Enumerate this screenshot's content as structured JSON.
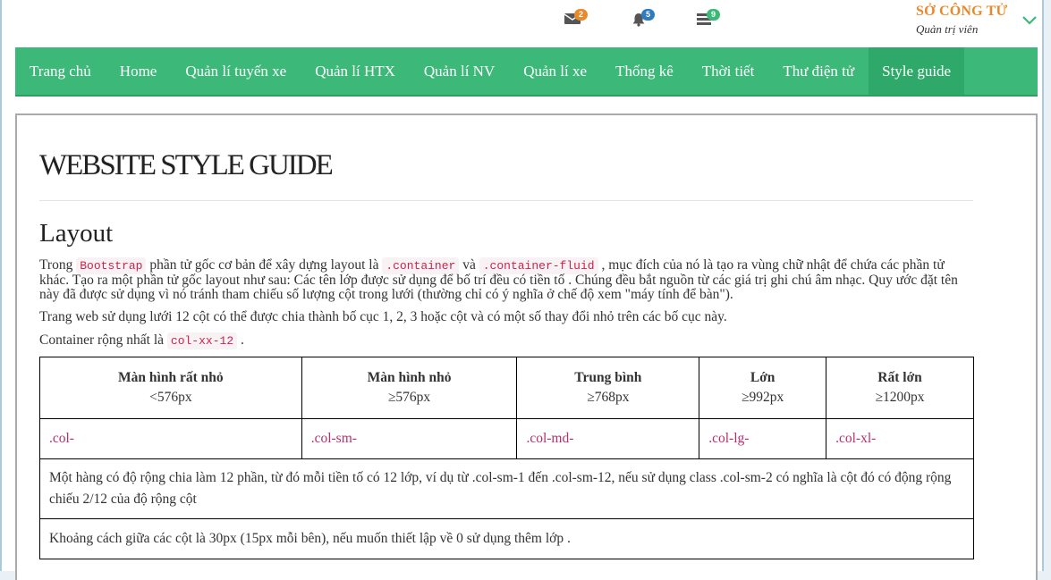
{
  "topbar": {
    "notifications": [
      {
        "icon": "envelope-icon",
        "count": "2",
        "color": "#e8892a"
      },
      {
        "icon": "bell-icon",
        "count": "5",
        "color": "#2e7bbf"
      },
      {
        "icon": "tasks-icon",
        "count": "9",
        "color": "#3cb878"
      }
    ],
    "user": {
      "name": "SỞ CÔNG TỬ",
      "role": "Quản trị viên"
    }
  },
  "nav": {
    "items": [
      "Trang chủ",
      "Home",
      "Quản lí tuyến xe",
      "Quản lí HTX",
      "Quản lí NV",
      "Quản lí xe",
      "Thống kê",
      "Thời tiết",
      "Thư điện tử",
      "Style guide"
    ],
    "active": "Style guide",
    "color": "#3cb878"
  },
  "content": {
    "title": "WEBSITE STYLE GUIDE",
    "section": "Layout",
    "p1": {
      "t1": "Trong ",
      "c1": "Bootstrap",
      "t2": " phần tử gốc cơ bản để xây dựng layout là ",
      "c2": ".container",
      "t3": " và ",
      "c3": ".container-fluid",
      "t4": " , mục đích của nó là tạo ra vùng chữ nhật để chứa các phần tử khác. Tạo ra một phần tử gốc layout như sau: Các tên lớp được sử dụng để bố trí đều có tiền tố . Chúng đều bắt nguồn từ các giá trị ghi chú âm nhạc. Quy ước đặt tên này đã được sử dụng vì nó tránh tham chiếu số lượng cột trong lưới (thường chỉ có ý nghĩa ở chế độ xem \"máy tính để bàn\")."
    },
    "p2": "Trang web sử dụng lưới 12 cột có thể được chia thành bố cục 1, 2, 3 hoặc cột và có một số thay đổi nhỏ trên các bố cục này.",
    "p3": {
      "t1": "Container rộng nhất là ",
      "c1": "col-xx-12",
      "t2": " ."
    },
    "table": {
      "headers": [
        {
          "name": "Màn hình rất nhỏ",
          "size": "<576px"
        },
        {
          "name": "Màn hình nhỏ",
          "size": "≥576px"
        },
        {
          "name": "Trung bình",
          "size": "≥768px"
        },
        {
          "name": "Lớn",
          "size": "≥992px"
        },
        {
          "name": "Rất lớn",
          "size": "≥1200px"
        }
      ],
      "classes": [
        ".col-",
        ".col-sm-",
        ".col-md-",
        ".col-lg-",
        ".col-xl-"
      ],
      "row_desc": "Một hàng có độ rộng chia làm 12 phần, từ đó mỗi tiền tố có 12 lớp, ví dụ từ .col-sm-1 đến .col-sm-12, nếu sử dụng class .col-sm-2 có nghĩa là cột đó có động rộng chiếu 2/12 của độ rộng cột",
      "row_gutter": "Khoảng cách giữa các cột là 30px (15px mỗi bên), nếu muốn thiết lập về 0 sử dụng thêm lớp ."
    }
  }
}
